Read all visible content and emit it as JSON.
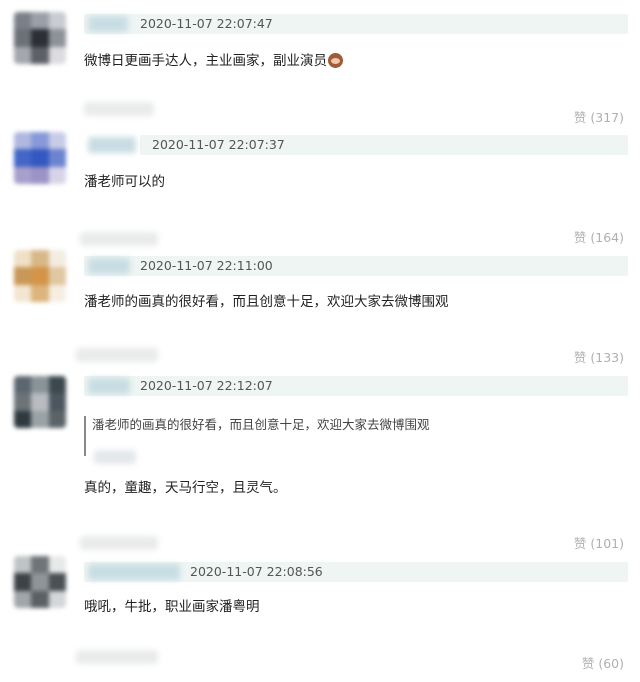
{
  "comments": [
    {
      "timestamp": "2020-11-07 22:07:47",
      "text": "微博日更画手达人，主业画家，副业演员",
      "emoji": "monkey-see-no-evil",
      "likes": "赞 (317)"
    },
    {
      "timestamp": "2020-11-07 22:07:37",
      "text": "潘老师可以的",
      "likes": "赞 (164)"
    },
    {
      "timestamp": "2020-11-07 22:11:00",
      "text": "潘老师的画真的很好看，而且创意十足，欢迎大家去微博围观",
      "likes": "赞 (133)"
    },
    {
      "timestamp": "2020-11-07 22:12:07",
      "quote": "潘老师的画真的很好看，而且创意十足，欢迎大家去微博围观",
      "text": "真的，童趣，天马行空，且灵气。",
      "likes": "赞 (101)"
    },
    {
      "timestamp": "2020-11-07 22:08:56",
      "text": "哦吼，牛批，职业画家潘粤明",
      "likes": "赞 (60)"
    }
  ],
  "colors": {
    "meta_bar": "#eef5f3",
    "like_text": "#b0b0b0",
    "body_text": "#222222"
  }
}
